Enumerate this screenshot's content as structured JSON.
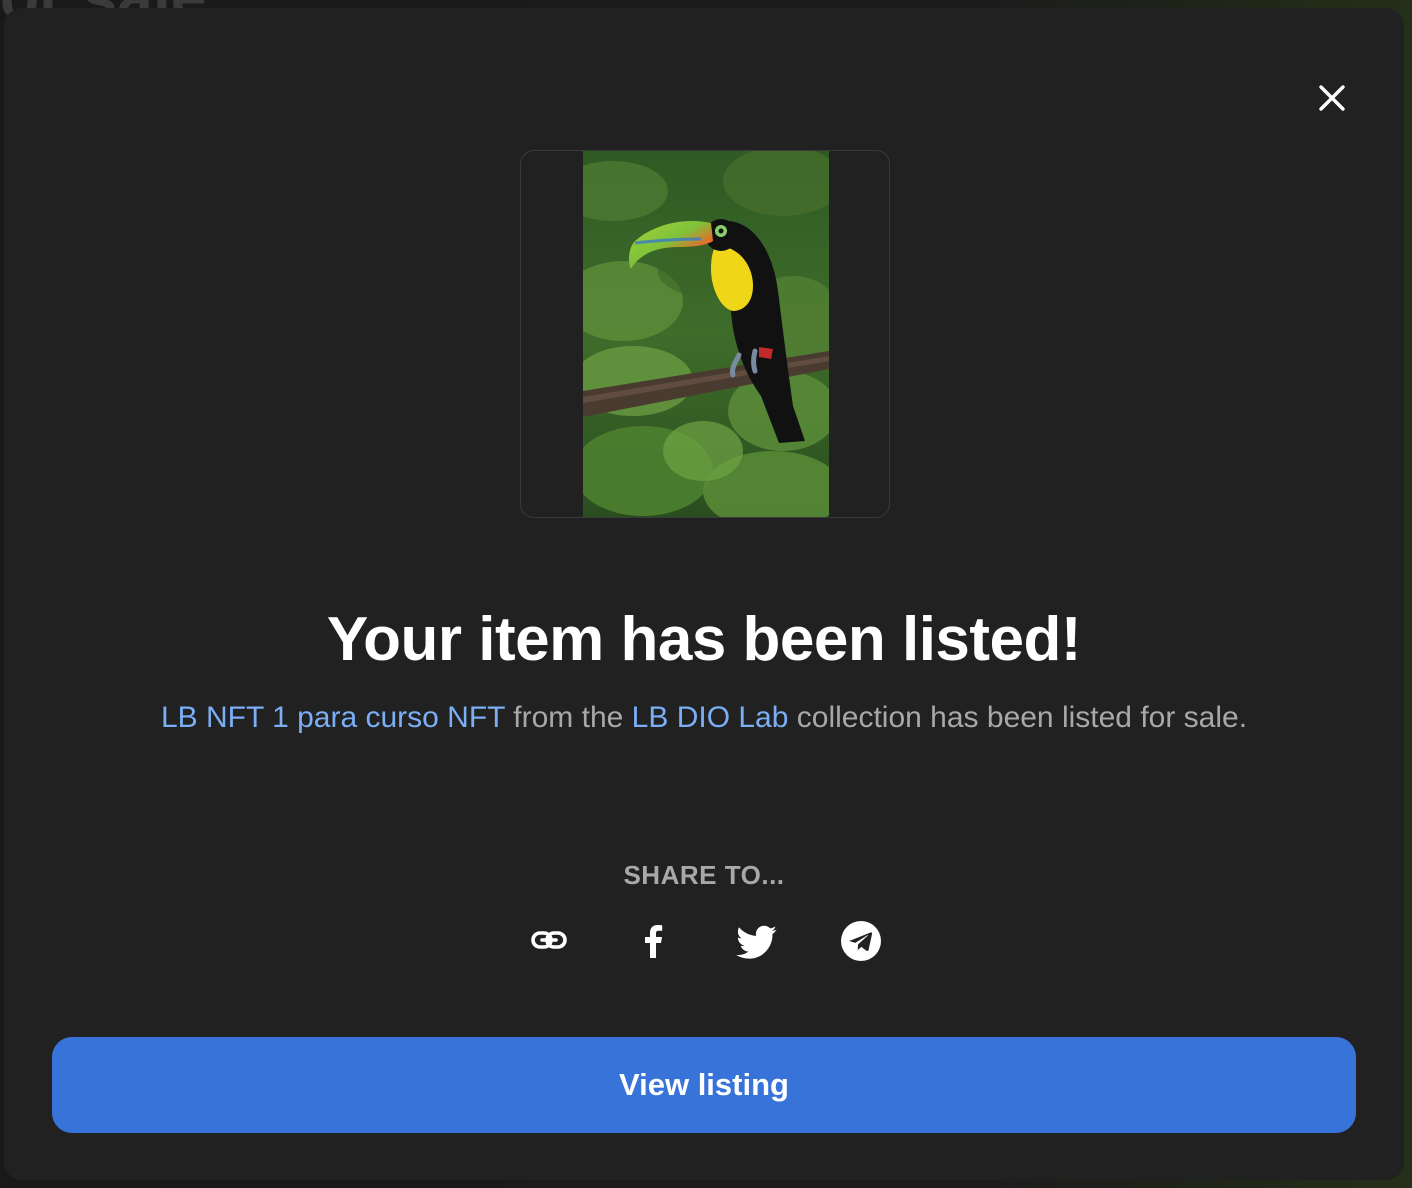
{
  "background": {
    "partial_text": "or sale"
  },
  "modal": {
    "close_icon": "close-icon",
    "title": "Your item has been listed!",
    "description": {
      "item_name": "LB NFT 1 para curso NFT",
      "text_1": " from the ",
      "collection_name": "LB DIO Lab",
      "text_2": " collection has been listed for sale."
    },
    "image_alt": "Toucan perched on a branch",
    "share": {
      "label": "SHARE TO...",
      "items": [
        {
          "name": "copy-link",
          "icon": "link-icon"
        },
        {
          "name": "facebook",
          "icon": "facebook-icon"
        },
        {
          "name": "twitter",
          "icon": "twitter-icon"
        },
        {
          "name": "telegram",
          "icon": "telegram-icon"
        }
      ]
    },
    "primary_button": "View listing"
  },
  "colors": {
    "modal_bg": "#212121",
    "accent_link": "#7aaef5",
    "button_bg": "#3873d9",
    "text_muted": "#a8a8a8",
    "text_primary": "#ffffff"
  }
}
